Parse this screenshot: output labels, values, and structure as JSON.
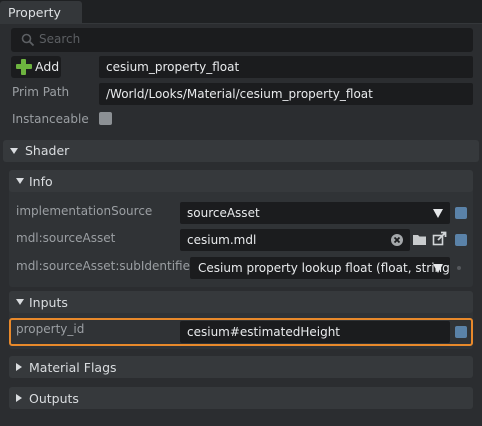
{
  "tab": {
    "title": "Property"
  },
  "search": {
    "placeholder": "Search",
    "icon": "search-icon"
  },
  "add_button": {
    "label": "Add"
  },
  "name_field": {
    "value": "cesium_property_float"
  },
  "prim_path": {
    "label": "Prim Path",
    "value": "/World/Looks/Material/cesium_property_float"
  },
  "instanceable": {
    "label": "Instanceable",
    "checked": false
  },
  "shader": {
    "title": "Shader",
    "info": {
      "title": "Info",
      "rows": [
        {
          "label": "implementationSource",
          "value": "sourceAsset"
        },
        {
          "label": "mdl:sourceAsset",
          "value": "cesium.mdl"
        },
        {
          "label": "mdl:sourceAsset:subIdentifier",
          "value": "Cesium property lookup float (float, string)"
        }
      ]
    },
    "inputs": {
      "title": "Inputs",
      "rows": [
        {
          "label": "property_id",
          "value": "cesium#estimatedHeight"
        }
      ]
    },
    "material_flags": {
      "title": "Material Flags"
    },
    "outputs": {
      "title": "Outputs"
    }
  },
  "colors": {
    "highlight": "#e8892b",
    "accent_box": "#5a82a8",
    "add_plus": "#6db33f"
  }
}
